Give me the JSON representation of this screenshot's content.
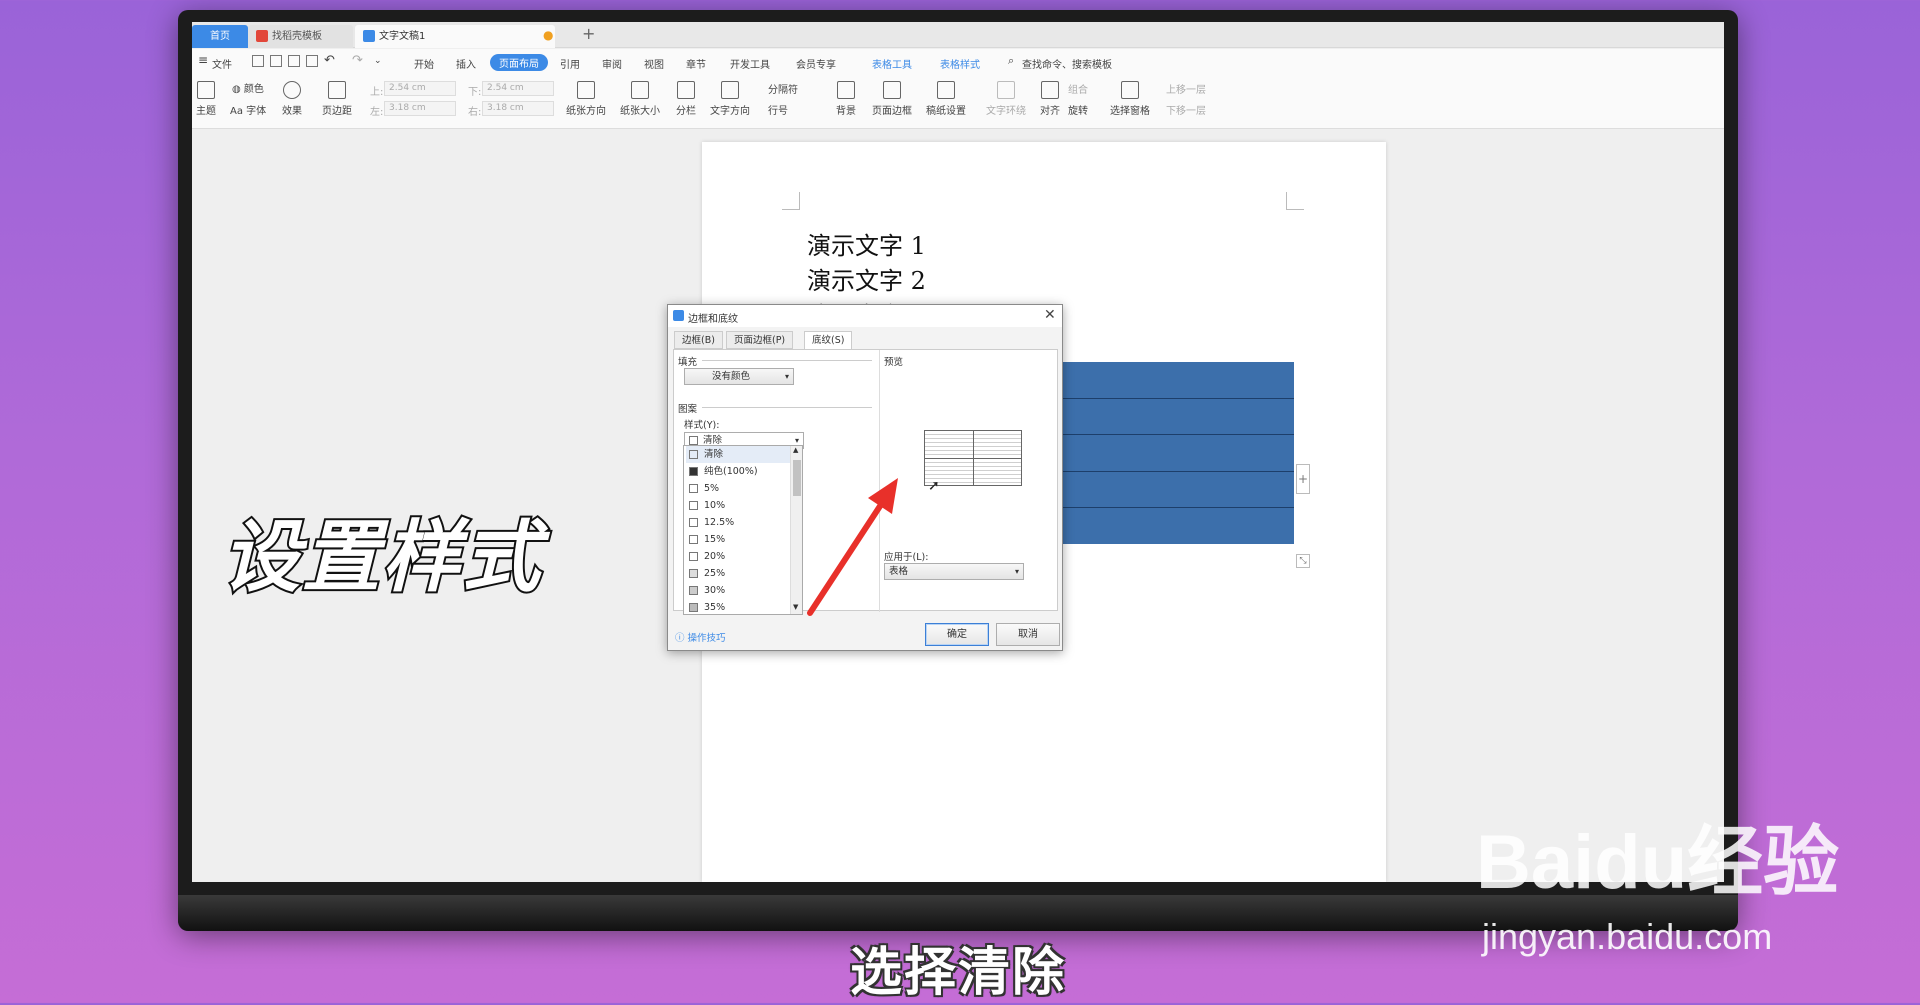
{
  "tabs": {
    "home": "首页",
    "template": "找稻壳模板",
    "doc": "文字文稿1",
    "new": "+"
  },
  "menu": {
    "file": "文件",
    "items": [
      "开始",
      "插入",
      "页面布局",
      "引用",
      "审阅",
      "视图",
      "章节",
      "开发工具",
      "会员专享"
    ],
    "active": "页面布局",
    "table_tools": "表格工具",
    "table_style": "表格样式",
    "search": "查找命令、搜索模板"
  },
  "ribbon": {
    "theme": "主题",
    "color": "颜色",
    "font": "Aa 字体",
    "effect": "效果",
    "margin": "页边距",
    "top_label": "上:",
    "top_val": "2.54 cm",
    "bottom_label": "下:",
    "bottom_val": "2.54 cm",
    "left_label": "左:",
    "left_val": "3.18 cm",
    "right_label": "右:",
    "right_val": "3.18 cm",
    "orientation": "纸张方向",
    "size": "纸张大小",
    "columns": "分栏",
    "text_dir": "文字方向",
    "breaks": "分隔符",
    "line_num": "行号",
    "background": "背景",
    "page_border": "页面边框",
    "grid": "稿纸设置",
    "wrap": "文字环绕",
    "align": "对齐",
    "rotate": "旋转",
    "group": "组合",
    "select_pane": "选择窗格",
    "bring_forward": "上移一层",
    "send_back": "下移一层"
  },
  "doc": {
    "lines": [
      "演示文字 1",
      "演示文字 2",
      "演示文字 3"
    ]
  },
  "dialog": {
    "title": "边框和底纹",
    "tabs": [
      "边框(B)",
      "页面边框(P)",
      "底纹(S)"
    ],
    "fill_label": "填充",
    "fill_value": "没有颜色",
    "pattern_label": "图案",
    "style_label": "样式(Y):",
    "style_value": "清除",
    "list": [
      "清除",
      "纯色(100%)",
      "5%",
      "10%",
      "12.5%",
      "15%",
      "20%",
      "25%",
      "30%",
      "35%"
    ],
    "preview_label": "预览",
    "apply_label": "应用于(L):",
    "apply_value": "表格",
    "tips": "操作技巧",
    "ok": "确定",
    "cancel": "取消"
  },
  "overlay": {
    "title": "设置样式",
    "subtitle": "选择清除",
    "wm_main": "Baidu经验",
    "wm_url": "jingyan.baidu.com"
  }
}
